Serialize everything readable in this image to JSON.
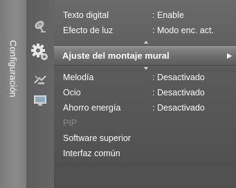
{
  "side_tab": {
    "label": "Configuración"
  },
  "icons": [
    {
      "name": "satellite-dish-icon"
    },
    {
      "name": "gear-icon",
      "active": true
    },
    {
      "name": "antenna-icon"
    },
    {
      "name": "monitor-icon"
    }
  ],
  "menu": {
    "items": [
      {
        "label": "Texto digital",
        "value": ": Enable"
      },
      {
        "label": "Efecto de luz",
        "value": ": Modo enc. act."
      },
      {
        "label": "Ajuste del montaje mural",
        "value": "",
        "selected": true
      },
      {
        "label": "Melodía",
        "value": ": Desactivado"
      },
      {
        "label": "Ocio",
        "value": ": Desactivado"
      },
      {
        "label": "Ahorro energía",
        "value": ": Desactivado"
      },
      {
        "label": "PIP",
        "value": "",
        "disabled": true
      },
      {
        "label": "Software superior",
        "value": ""
      },
      {
        "label": "Interfaz común",
        "value": ""
      }
    ]
  },
  "colors": {
    "text": "#ffffff",
    "disabled_text": "#8c8c8c",
    "selection": "#7a7a7a"
  }
}
